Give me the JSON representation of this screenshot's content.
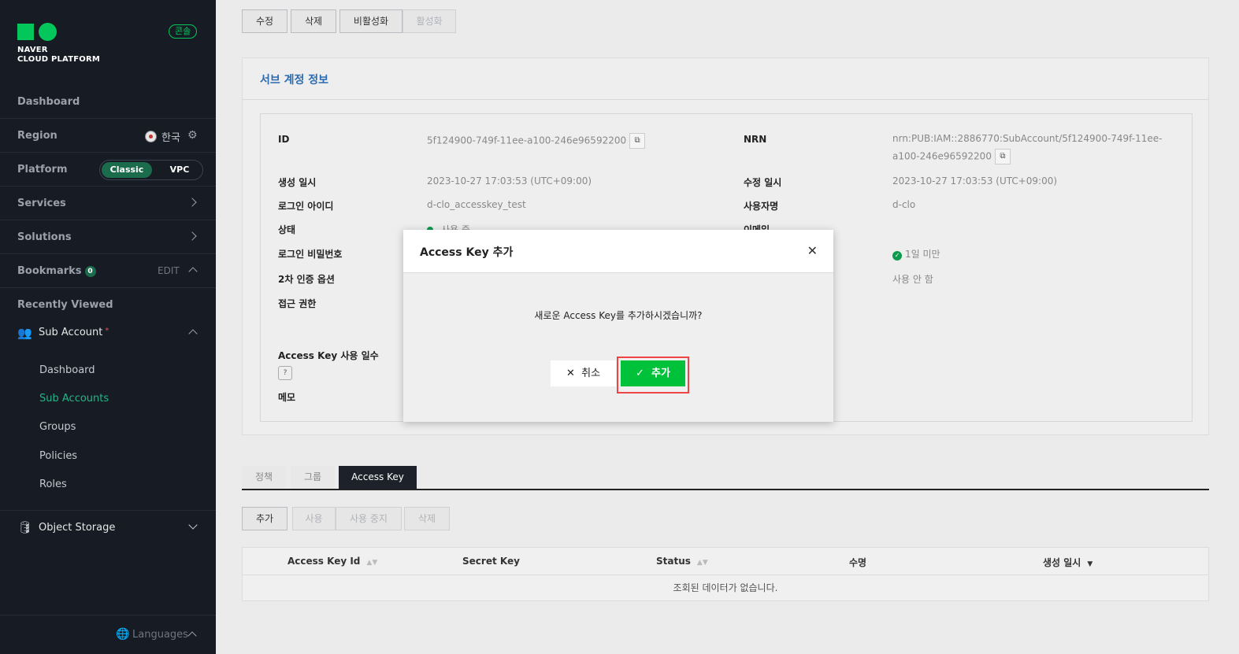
{
  "sidebar": {
    "logo_line1": "NAVER",
    "logo_line2": "CLOUD PLATFORM",
    "console_badge": "콘솔",
    "dashboard": "Dashboard",
    "region_label": "Region",
    "region_value": "한국",
    "platform_label": "Platform",
    "platform_classic": "Classic",
    "platform_vpc": "VPC",
    "services": "Services",
    "solutions": "Solutions",
    "bookmarks": "Bookmarks",
    "bookmarks_count": "0",
    "bookmarks_edit": "EDIT",
    "recently_viewed": "Recently Viewed",
    "sub_account": "Sub Account",
    "sub_items": [
      "Dashboard",
      "Sub Accounts",
      "Groups",
      "Policies",
      "Roles"
    ],
    "object_storage": "Object Storage",
    "languages": "Languages"
  },
  "top_buttons": [
    "수정",
    "삭제",
    "비활성화",
    "활성화"
  ],
  "panel": {
    "title": "서브 계정 정보",
    "id_label": "ID",
    "id_value": "5f124900-749f-11ee-a100-246e96592200",
    "nrn_label": "NRN",
    "nrn_line1": "nrn:PUB:IAM::2886770:SubAccount/5f124900-749f-11ee-",
    "nrn_line2": "a100-246e96592200",
    "created_label": "생성 일시",
    "created_value": "2023-10-27 17:03:53 (UTC+09:00)",
    "modified_label": "수정 일시",
    "modified_value": "2023-10-27 17:03:53 (UTC+09:00)",
    "login_id_label": "로그인 아이디",
    "login_id_value": "d-clo_accesskey_test",
    "username_label": "사용자명",
    "username_value": "d-clo",
    "status_label": "상태",
    "status_value": "사용 중",
    "email_label": "이메일",
    "login_pw_label": "로그인 비밀번호",
    "pw_age_value": "1일 미만",
    "mfa_label": "2차 인증 옵션",
    "mfa_value": "사용 안 함",
    "access_label": "접근 권한",
    "key_days_label": "Access Key 사용 일수",
    "memo_label": "메모"
  },
  "tabs": [
    "정책",
    "그룹",
    "Access Key"
  ],
  "action_buttons": [
    "추가",
    "사용",
    "사용 중지",
    "삭제"
  ],
  "table": {
    "headers": [
      "Access Key Id",
      "Secret Key",
      "Status",
      "수명",
      "생성 일시"
    ],
    "empty": "조회된 데이터가 없습니다."
  },
  "modal": {
    "title": "Access Key 추가",
    "message": "새로운 Access Key를 추가하시겠습니까?",
    "cancel": "취소",
    "confirm": "추가"
  },
  "colors": {
    "sidebar_bg": "#171c24",
    "brand_green": "#03c75a",
    "confirm_green": "#00c23a",
    "highlight_red": "#ee4444",
    "title_blue": "#2a6bb0"
  }
}
